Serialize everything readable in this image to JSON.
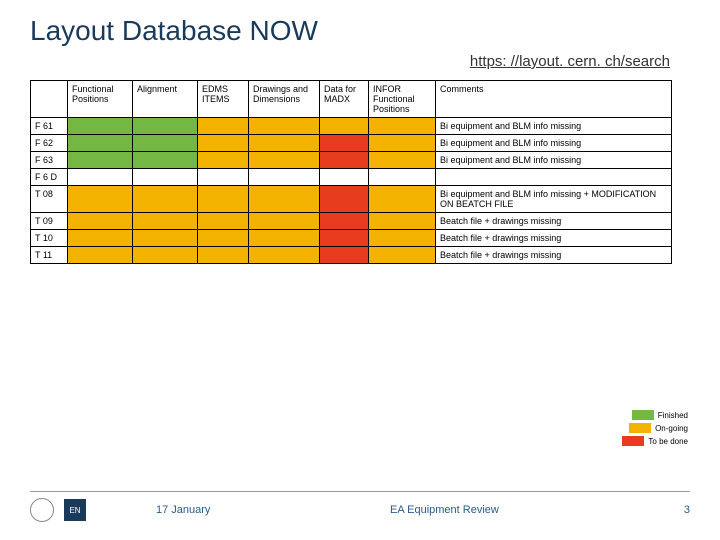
{
  "title": "Layout Database NOW",
  "link": "https: //layout. cern. ch/search",
  "columns": {
    "id": "",
    "fp": "Functional Positions",
    "al": "Alignment",
    "ed": "EDMS ITEMS",
    "dw": "Drawings and Dimensions",
    "dm": "Data for MADX",
    "in": "INFOR Functional Positions",
    "cm": "Comments"
  },
  "rows": [
    {
      "id": "F 61",
      "cells": [
        "green",
        "green",
        "orange",
        "orange",
        "orange",
        "orange"
      ],
      "comment": "Bi equipment and BLM info missing"
    },
    {
      "id": "F 62",
      "cells": [
        "green",
        "green",
        "orange",
        "orange",
        "red",
        "orange"
      ],
      "comment": "Bi equipment and BLM info missing"
    },
    {
      "id": "F 63",
      "cells": [
        "green",
        "green",
        "orange",
        "orange",
        "red",
        "orange"
      ],
      "comment": "Bi equipment and BLM info missing"
    },
    {
      "id": "F 6 D",
      "cells": [
        "",
        "",
        "",
        "",
        "",
        ""
      ],
      "comment": ""
    },
    {
      "id": "T 08",
      "cells": [
        "orange",
        "orange",
        "orange",
        "orange",
        "red",
        "orange"
      ],
      "comment": "Bi equipment and BLM info missing + MODIFICATION ON BEATCH FILE"
    },
    {
      "id": "T 09",
      "cells": [
        "orange",
        "orange",
        "orange",
        "orange",
        "red",
        "orange"
      ],
      "comment": "Beatch file + drawings missing"
    },
    {
      "id": "T 10",
      "cells": [
        "orange",
        "orange",
        "orange",
        "orange",
        "red",
        "orange"
      ],
      "comment": "Beatch file + drawings missing"
    },
    {
      "id": "T 11",
      "cells": [
        "orange",
        "orange",
        "orange",
        "orange",
        "red",
        "orange"
      ],
      "comment": "Beatch file + drawings missing"
    }
  ],
  "legend": {
    "finished": "Finished",
    "ongoing": "On-going",
    "todo": "To be done"
  },
  "footer": {
    "date": "17 January",
    "name": "EA Equipment Review",
    "page": "3",
    "logo1": "",
    "logo2": "EN"
  }
}
